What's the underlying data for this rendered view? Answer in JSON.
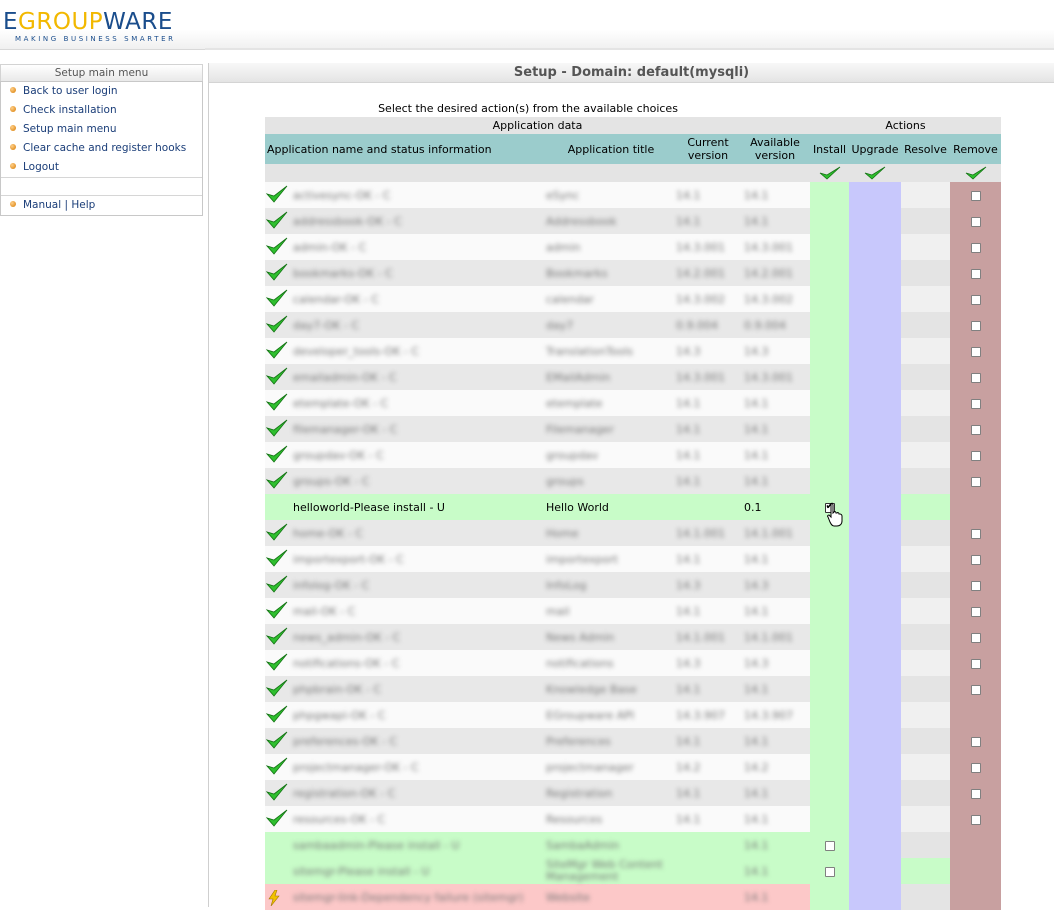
{
  "logo": {
    "part1": "E",
    "part2": "GROUP",
    "part3": "WARE",
    "tagline": "MAKING BUSINESS SMARTER"
  },
  "sidebar": {
    "title": "Setup main menu",
    "items": [
      {
        "label": "Back to user login"
      },
      {
        "label": "Check installation"
      },
      {
        "label": "Setup main menu"
      },
      {
        "label": "Clear cache and register hooks"
      },
      {
        "label": "Logout"
      }
    ],
    "manual": "Manual",
    "sep": "|",
    "help": "Help"
  },
  "main": {
    "title": "Setup - Domain: default(mysqli)",
    "intro": "Select the desired action(s) from the available choices"
  },
  "table": {
    "group_headers": {
      "app_data": "Application data",
      "actions": "Actions"
    },
    "columns": {
      "name": "Application name and status information",
      "title": "Application title",
      "current": "Current version",
      "available": "Available version",
      "install": "Install",
      "upgrade": "Upgrade",
      "resolve": "Resolve",
      "remove": "Remove"
    },
    "rows": [
      {
        "name": "activesync-OK - C",
        "title": "eSync",
        "current": "14.1",
        "available": "14.1",
        "status": "ok",
        "remove": true
      },
      {
        "name": "addressbook-OK - C",
        "title": "Addressbook",
        "current": "14.1",
        "available": "14.1",
        "status": "ok",
        "remove": true
      },
      {
        "name": "admin-OK - C",
        "title": "admin",
        "current": "14.3.001",
        "available": "14.3.001",
        "status": "ok",
        "remove": true
      },
      {
        "name": "bookmarks-OK - C",
        "title": "Bookmarks",
        "current": "14.2.001",
        "available": "14.2.001",
        "status": "ok",
        "remove": true
      },
      {
        "name": "calendar-OK - C",
        "title": "calendar",
        "current": "14.3.002",
        "available": "14.3.002",
        "status": "ok",
        "remove": true
      },
      {
        "name": "day7-OK - C",
        "title": "day7",
        "current": "0.9.004",
        "available": "0.9.004",
        "status": "ok",
        "remove": true
      },
      {
        "name": "developer_tools-OK - C",
        "title": "TranslationTools",
        "current": "14.3",
        "available": "14.3",
        "status": "ok",
        "remove": true
      },
      {
        "name": "emailadmin-OK - C",
        "title": "EMailAdmin",
        "current": "14.3.001",
        "available": "14.3.001",
        "status": "ok",
        "remove": true
      },
      {
        "name": "etemplate-OK - C",
        "title": "etemplate",
        "current": "14.1",
        "available": "14.1",
        "status": "ok",
        "remove": true
      },
      {
        "name": "filemanager-OK - C",
        "title": "Filemanager",
        "current": "14.1",
        "available": "14.1",
        "status": "ok",
        "remove": true
      },
      {
        "name": "groupdav-OK - C",
        "title": "groupdav",
        "current": "14.1",
        "available": "14.1",
        "status": "ok",
        "remove": true
      },
      {
        "name": "groups-OK - C",
        "title": "groups",
        "current": "14.1",
        "available": "14.1",
        "status": "ok",
        "remove": true
      },
      {
        "name": "helloworld-Please install - U",
        "title": "Hello World",
        "current": "",
        "available": "0.1",
        "status": "install",
        "install_checked": true
      },
      {
        "name": "home-OK - C",
        "title": "Home",
        "current": "14.1.001",
        "available": "14.1.001",
        "status": "ok",
        "remove": true
      },
      {
        "name": "importexport-OK - C",
        "title": "importexport",
        "current": "14.1",
        "available": "14.1",
        "status": "ok",
        "remove": true
      },
      {
        "name": "infolog-OK - C",
        "title": "InfoLog",
        "current": "14.3",
        "available": "14.3",
        "status": "ok",
        "remove": true
      },
      {
        "name": "mail-OK - C",
        "title": "mail",
        "current": "14.1",
        "available": "14.1",
        "status": "ok",
        "remove": true
      },
      {
        "name": "news_admin-OK - C",
        "title": "News Admin",
        "current": "14.1.001",
        "available": "14.1.001",
        "status": "ok",
        "remove": true
      },
      {
        "name": "notifications-OK - C",
        "title": "notifications",
        "current": "14.3",
        "available": "14.3",
        "status": "ok",
        "remove": true
      },
      {
        "name": "phpbrain-OK - C",
        "title": "Knowledge Base",
        "current": "14.1",
        "available": "14.1",
        "status": "ok",
        "remove": true
      },
      {
        "name": "phpgwapi-OK - C",
        "title": "EGroupware API",
        "current": "14.3.907",
        "available": "14.3.907",
        "status": "ok",
        "remove": false
      },
      {
        "name": "preferences-OK - C",
        "title": "Preferences",
        "current": "14.1",
        "available": "14.1",
        "status": "ok",
        "remove": true
      },
      {
        "name": "projectmanager-OK - C",
        "title": "projectmanager",
        "current": "14.2",
        "available": "14.2",
        "status": "ok",
        "remove": true
      },
      {
        "name": "registration-OK - C",
        "title": "Registration",
        "current": "14.1",
        "available": "14.1",
        "status": "ok",
        "remove": true
      },
      {
        "name": "resources-OK - C",
        "title": "Resources",
        "current": "14.1",
        "available": "14.1",
        "status": "ok",
        "remove": true
      },
      {
        "name": "sambaadmin-Please install - U",
        "title": "SambaAdmin",
        "current": "",
        "available": "14.1",
        "status": "install",
        "install_checked": false
      },
      {
        "name": "sitemgr-Please install - U",
        "title": "SiteMgr Web Content Management",
        "current": "",
        "available": "14.1",
        "status": "install",
        "install_checked": false
      },
      {
        "name": "sitemgr-link-Dependency failure (sitemgr)",
        "title": "Website",
        "current": "",
        "available": "14.1",
        "status": "depfail"
      }
    ]
  },
  "colors": {
    "header_col": "#9bcccc",
    "install_col": "#c8fcc8",
    "upgrade_col": "#c8c8fc",
    "remove_col": "#c8a0a0",
    "depfail": "#fcc8c8"
  },
  "icons": {
    "ok": "green-check-icon",
    "depfail": "lightning-icon",
    "cursor": "hand-cursor-icon"
  }
}
